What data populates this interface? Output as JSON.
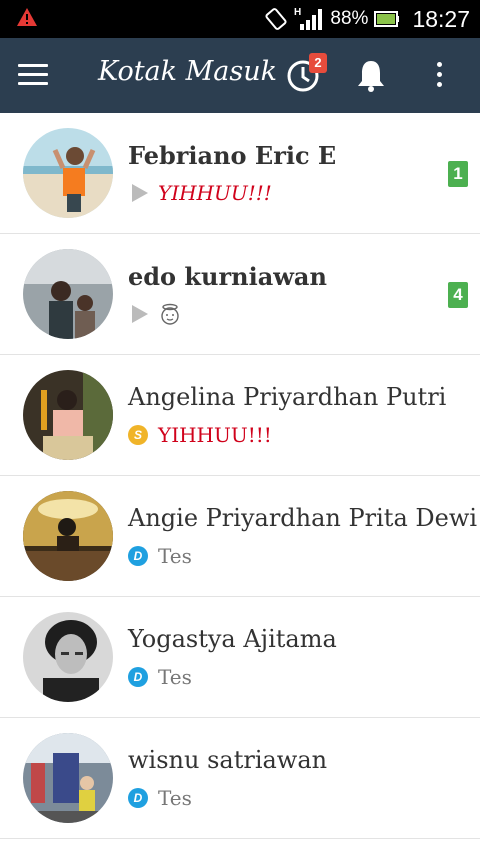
{
  "status_bar": {
    "battery_percent": "88%",
    "time": "18:27",
    "network": "H",
    "colors": {
      "warning": "#e53935",
      "battery": "#8bc34a"
    }
  },
  "app_bar": {
    "title": "Kotak Masuk",
    "history_badge": "2",
    "icons": [
      "menu-icon",
      "history-icon",
      "bell-icon",
      "more-vert-icon"
    ],
    "background": "#2c3e50"
  },
  "conversations": [
    {
      "name": "Febriano Eric E",
      "preview": "YIHHUU!!!",
      "preview_style": "red-italic",
      "indicator": "play",
      "unread": "1",
      "bold": true
    },
    {
      "name": "edo kurniawan",
      "preview": "",
      "preview_icon": "angel-emoji-icon",
      "indicator": "play",
      "unread": "4",
      "bold": true
    },
    {
      "name": "Angelina Priyardhan Putri",
      "preview": "YIHHUU!!!",
      "preview_style": "red",
      "indicator": "S",
      "bold": false
    },
    {
      "name": "Angie Priyardhan Prita Dewi",
      "preview": "Tes",
      "preview_style": "gray",
      "indicator": "D",
      "bold": false
    },
    {
      "name": "Yogastya Ajitama",
      "preview": "Tes",
      "preview_style": "gray",
      "indicator": "D",
      "bold": false
    },
    {
      "name": "wisnu satriawan",
      "preview": "Tes",
      "preview_style": "gray",
      "indicator": "D",
      "bold": false
    }
  ]
}
